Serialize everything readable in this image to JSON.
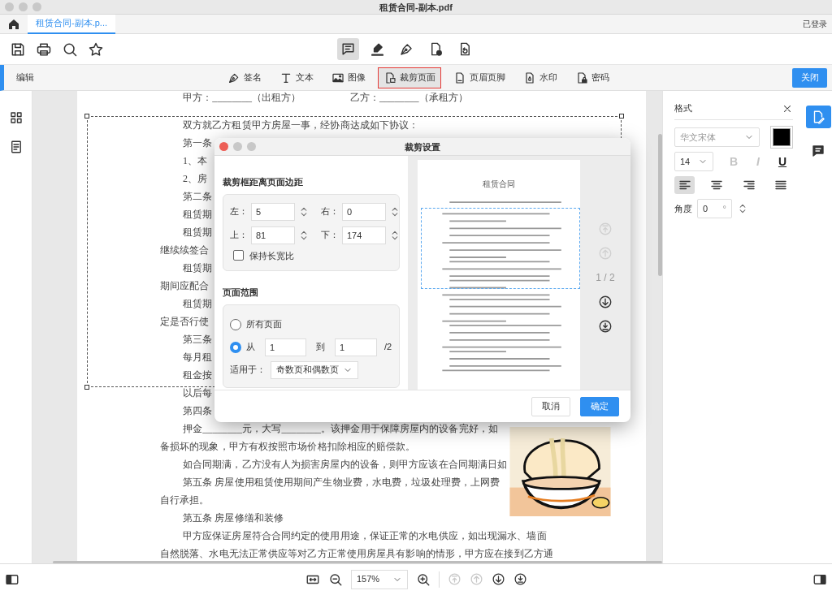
{
  "window": {
    "title": "租赁合同-副本.pdf"
  },
  "tabs": [
    {
      "label": "租赁合同-副本.p...",
      "selected": true
    }
  ],
  "account": "已登录",
  "modes": [
    {
      "kind": "comment",
      "selected": true
    },
    {
      "kind": "highlight",
      "selected": false
    },
    {
      "kind": "pen",
      "selected": false
    },
    {
      "kind": "page-remove",
      "selected": false
    },
    {
      "kind": "page-rotate",
      "selected": false
    }
  ],
  "edit_bar": {
    "label": "编辑",
    "close_button": "关闭",
    "tools": [
      {
        "kind": "sign",
        "label": "签名",
        "selected": false
      },
      {
        "kind": "text",
        "label": "文本",
        "selected": false
      },
      {
        "kind": "image",
        "label": "图像",
        "selected": false
      },
      {
        "kind": "crop",
        "label": "裁剪页面",
        "selected": true
      },
      {
        "kind": "header",
        "label": "页眉页脚",
        "selected": false
      },
      {
        "kind": "watermark",
        "label": "水印",
        "selected": false
      },
      {
        "kind": "password",
        "label": "密码",
        "selected": false
      }
    ]
  },
  "document": {
    "parties": [
      "甲方：________（出租方）",
      "乙方：________（承租方）"
    ],
    "lines": [
      {
        "text": "双方就乙方租赁甲方房屋一事，经协商达成如下协议：",
        "indent": true
      },
      {
        "text": "第一条",
        "indent": true
      },
      {
        "text": "1、本",
        "indent": true
      },
      {
        "text": "2、房",
        "indent": true
      },
      {
        "text": "第二条",
        "indent": true
      },
      {
        "text": "租赁期",
        "indent": true
      },
      {
        "text": "租赁期",
        "indent": true
      },
      {
        "text": "继续续签合",
        "indent": false
      },
      {
        "text": "租赁期",
        "indent": true
      },
      {
        "text": "期间应配合",
        "indent": false
      },
      {
        "text": "租赁期",
        "indent": true
      },
      {
        "text": "定是否行使",
        "indent": false
      },
      {
        "text": "第三条",
        "indent": true
      },
      {
        "text": "每月租",
        "indent": true
      },
      {
        "text": "租金按",
        "indent": true
      },
      {
        "text": "以后每",
        "indent": true
      },
      {
        "text": "第四条",
        "indent": true
      },
      {
        "text": "押金________元，大写________。该押金用于保障房屋内的设备完好，如",
        "indent": true
      },
      {
        "text": "备损坏的现象，甲方有权按照市场价格扣除相应的赔偿款。",
        "indent": false
      },
      {
        "text": "如合同期满，乙方没有人为损害房屋内的设备，则甲方应该在合同期满日如",
        "indent": true
      },
      {
        "text": "第五条 房屋使用租赁使用期间产生物业费，水电费，垃圾处理费，上网费",
        "indent": true
      },
      {
        "text": "自行承担。",
        "indent": false
      },
      {
        "text": "第五条 房屋修缮和装修",
        "indent": true
      },
      {
        "text": "甲方应保证房屋符合合同约定的使用用途，保证正常的水电供应，如出现漏水、墙面",
        "indent": true
      },
      {
        "text": "自然脱落、水电无法正常供应等对乙方正常使用房屋具有影响的情形，甲方应在接到乙方通",
        "indent": false
      }
    ]
  },
  "format_panel": {
    "title": "格式",
    "font": "华文宋体",
    "color": "#000000",
    "size": "14",
    "styles": [
      {
        "kind": "bold",
        "label": "B",
        "disabled": true
      },
      {
        "kind": "italic",
        "label": "I",
        "disabled": true
      },
      {
        "kind": "underline",
        "label": "U",
        "disabled": false
      }
    ],
    "align": [
      {
        "kind": "left",
        "selected": true
      },
      {
        "kind": "center",
        "selected": false
      },
      {
        "kind": "right",
        "selected": false
      },
      {
        "kind": "justify",
        "selected": false
      }
    ],
    "angle_label": "角度",
    "angle": "0",
    "angle_unit": "°"
  },
  "right_rail": [
    {
      "kind": "edit",
      "selected": true
    },
    {
      "kind": "comment",
      "selected": false
    }
  ],
  "bottom_bar": {
    "zoom": "157%",
    "nav": [
      {
        "kind": "first",
        "disabled": true
      },
      {
        "kind": "prev",
        "disabled": true
      },
      {
        "kind": "next",
        "disabled": false
      },
      {
        "kind": "last",
        "disabled": false
      }
    ]
  },
  "dialog": {
    "title": "裁剪设置",
    "margins_label": "裁剪框距离页面边距",
    "margins": [
      {
        "label": "左：",
        "value": "5"
      },
      {
        "label": "右：",
        "value": "0"
      },
      {
        "label": "上：",
        "value": "81"
      },
      {
        "label": "下：",
        "value": "174"
      }
    ],
    "keep_ratio": {
      "label": "保持长宽比",
      "checked": false
    },
    "range_label": "页面范围",
    "range_options": [
      {
        "label": "所有页面",
        "selected": false
      },
      {
        "label": "从",
        "selected": true
      }
    ],
    "from": "1",
    "to_label": "到",
    "to": "1",
    "total": "/2",
    "apply_label": "适用于：",
    "apply_value": "奇数页和偶数页",
    "preview": {
      "title": "租赁合同",
      "page_indicator": "1 / 2",
      "nav": [
        {
          "kind": "first",
          "disabled": true
        },
        {
          "kind": "prev",
          "disabled": true
        },
        {
          "kind": "next",
          "disabled": false
        },
        {
          "kind": "last",
          "disabled": false
        }
      ]
    },
    "buttons": [
      {
        "label": "取消",
        "primary": false
      },
      {
        "label": "确定",
        "primary": true
      }
    ]
  }
}
